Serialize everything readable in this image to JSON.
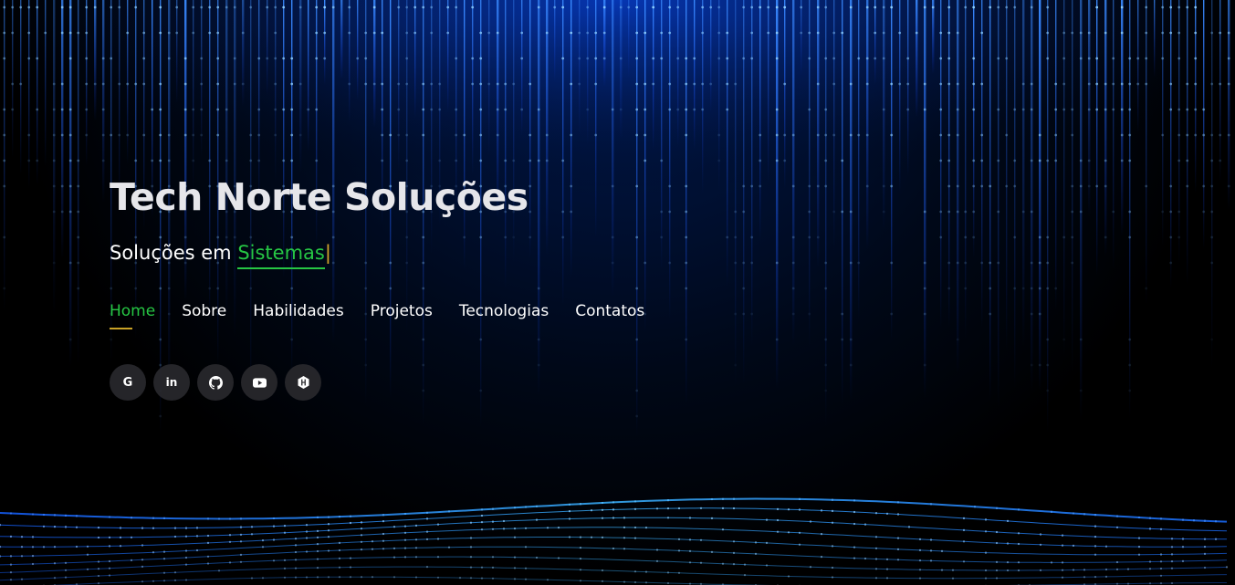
{
  "hero": {
    "title": "Tech Norte Soluções",
    "subtitle_prefix": "Soluções em ",
    "subtitle_typed": "Sistemas",
    "subtitle_cursor": "|"
  },
  "nav": {
    "items": [
      {
        "label": "Home",
        "active": true
      },
      {
        "label": "Sobre"
      },
      {
        "label": "Habilidades"
      },
      {
        "label": "Projetos"
      },
      {
        "label": "Tecnologias"
      },
      {
        "label": "Contatos"
      }
    ]
  },
  "social": {
    "icons": [
      {
        "name": "google-icon",
        "glyph": "G"
      },
      {
        "name": "linkedin-icon",
        "glyph": "in"
      },
      {
        "name": "github-icon"
      },
      {
        "name": "youtube-icon"
      },
      {
        "name": "hackerrank-icon"
      }
    ]
  },
  "colors": {
    "accent_green": "#26c644",
    "accent_gold": "#c9a227",
    "matrix_blue": "#1e6bff",
    "background": "#000000"
  }
}
